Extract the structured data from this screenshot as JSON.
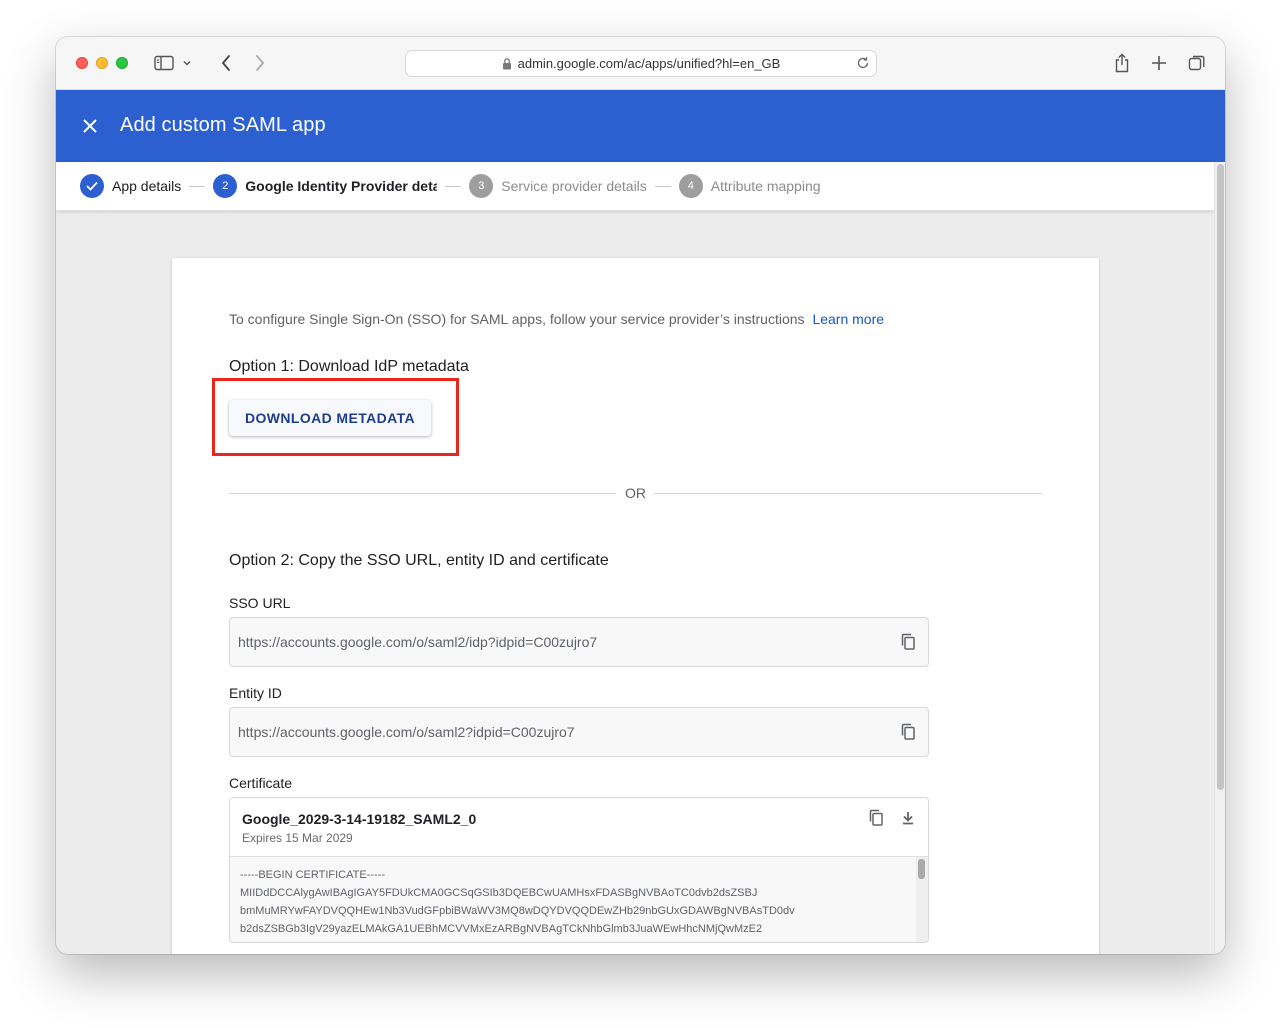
{
  "browser": {
    "url": "admin.google.com/ac/apps/unified?hl=en_GB"
  },
  "header": {
    "title": "Add custom SAML app"
  },
  "stepper": {
    "steps": [
      {
        "number": "",
        "label": "App details",
        "state": "done"
      },
      {
        "number": "2",
        "label": "Google Identity Provider details",
        "state": "active"
      },
      {
        "number": "3",
        "label": "Service provider details",
        "state": "todo"
      },
      {
        "number": "4",
        "label": "Attribute mapping",
        "state": "todo"
      }
    ]
  },
  "card": {
    "intro_text": "To configure Single Sign-On (SSO) for SAML apps, follow your service provider’s instructions",
    "learn_more": "Learn more",
    "option1_heading": "Option 1: Download IdP metadata",
    "download_button": "DOWNLOAD METADATA",
    "or_text": "OR",
    "option2_heading": "Option 2: Copy the SSO URL, entity ID and certificate",
    "sso_url_label": "SSO URL",
    "sso_url_value": "https://accounts.google.com/o/saml2/idp?idpid=C00zujro7",
    "entity_id_label": "Entity ID",
    "entity_id_value": "https://accounts.google.com/o/saml2?idpid=C00zujro7",
    "certificate_label": "Certificate",
    "certificate": {
      "name": "Google_2029-3-14-19182_SAML2_0",
      "expires": "Expires 15 Mar 2029",
      "lines": [
        "-----BEGIN CERTIFICATE-----",
        "MIIDdDCCAlygAwIBAgIGAY5FDUkCMA0GCSqGSIb3DQEBCwUAMHsxFDASBgNVBAoTC0dvb2dsZSBJ",
        "bmMuMRYwFAYDVQQHEw1Nb3VudGFpbiBWaWV3MQ8wDQYDVQQDEwZHb29nbGUxGDAWBgNVBAsTD0dv",
        "b2dsZSBGb3IgV29yazELMAkGA1UEBhMCVVMxEzARBgNVBAgTCkNhbGlmb3JuaWEwHhcNMjQwMzE2"
      ]
    }
  },
  "colors": {
    "header_blue": "#2c5fcf",
    "link_blue": "#1a55c7",
    "highlight_red": "#e8261c"
  }
}
